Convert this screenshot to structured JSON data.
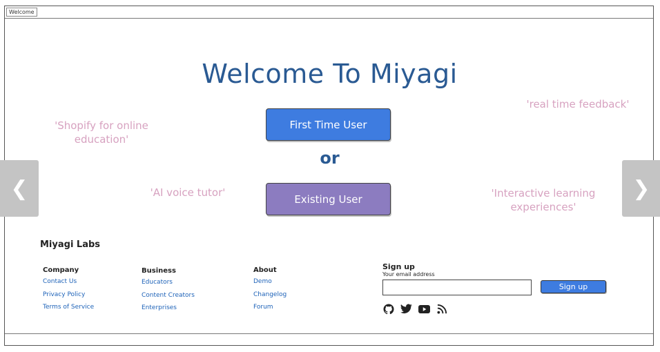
{
  "window": {
    "title": "Welcome"
  },
  "hero": {
    "headline": "Welcome To Miyagi",
    "first_time_label": "First Time User",
    "or_text": "or",
    "existing_label": "Existing User"
  },
  "quotes": {
    "shopify": "'Shopify for online education'",
    "realtime": "'real time feedback'",
    "ai_voice": "'AI voice tutor'",
    "interactive": "'Interactive learning experiences'"
  },
  "carousel": {
    "prev_glyph": "❮",
    "next_glyph": "❯"
  },
  "footer": {
    "brand": "Miyagi Labs",
    "columns": [
      {
        "heading": "Company",
        "links": [
          "Contact Us",
          "Privacy Policy",
          "Terms of Service"
        ]
      },
      {
        "heading": "Business",
        "links": [
          "Educators",
          "Content Creators",
          "Enterprises"
        ]
      },
      {
        "heading": "About",
        "links": [
          "Demo",
          "Changelog",
          "Forum"
        ]
      }
    ],
    "signup": {
      "title": "Sign up",
      "subtitle": "Your email address",
      "email_value": "",
      "button_label": "Sign up"
    },
    "socials": [
      "github-icon",
      "twitter-icon",
      "youtube-icon",
      "rss-icon"
    ]
  },
  "colors": {
    "headline": "#2a5a93",
    "primary_button": "#3e7ce0",
    "secondary_button": "#8c7cc0",
    "quote_text": "#d7a2c0",
    "link": "#1d62b8"
  }
}
